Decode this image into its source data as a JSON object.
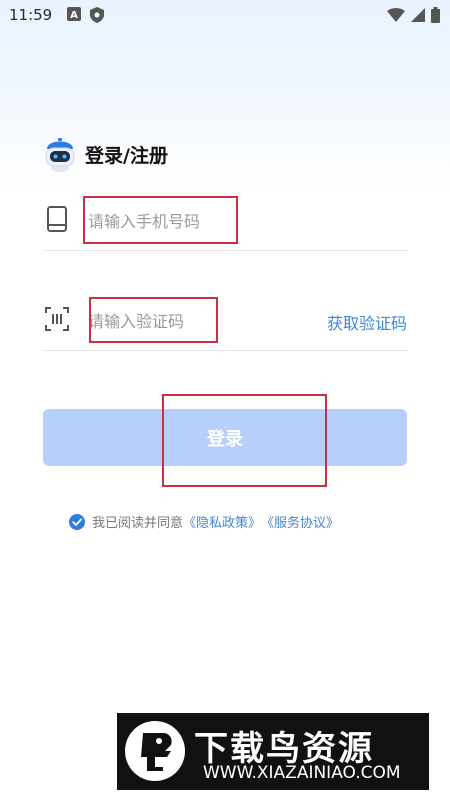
{
  "status_bar": {
    "time": "11:59",
    "icons_left": [
      "font-a-icon",
      "shield-icon"
    ],
    "icons_right": [
      "wifi-icon",
      "signal-icon",
      "battery-icon"
    ]
  },
  "header": {
    "title": "登录/注册",
    "logo_icon": "robot-mascot-icon"
  },
  "form": {
    "phone": {
      "icon": "phone-icon",
      "value": "",
      "placeholder": "请输入手机号码"
    },
    "code": {
      "icon": "scan-code-icon",
      "value": "",
      "placeholder": "请输入验证码",
      "get_code_label": "获取验证码"
    },
    "login_label": "登录",
    "login_enabled": false
  },
  "agreement": {
    "checked": true,
    "prefix": "我已阅读并同意",
    "privacy_label": "《隐私政策》",
    "terms_label": "《服务协议》"
  },
  "watermark": {
    "brand": "下载鸟资源",
    "url": "WWW.XIAZAINIAO.COM"
  },
  "colors": {
    "accent": "#3c87d8",
    "button_disabled": "#b7d0fb",
    "annotation": "#c9313f",
    "checkbox": "#2f7ce0"
  }
}
